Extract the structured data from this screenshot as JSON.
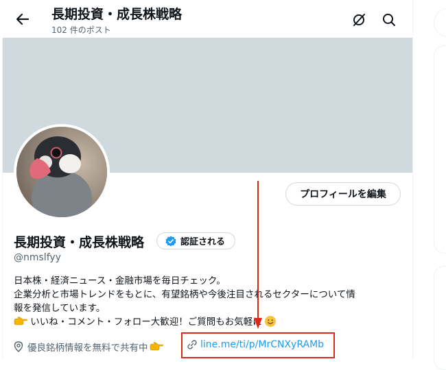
{
  "header": {
    "title": "長期投資・成長株戦略",
    "post_count": "102 件のポスト",
    "icons": [
      "back-arrow-icon",
      "grok-icon",
      "search-icon"
    ]
  },
  "profile": {
    "edit_button": "プロフィールを編集",
    "name": "長期投資・成長株戦略",
    "verify_button": "認証される",
    "handle": "@nmslfyy",
    "bio": [
      "日本株・経済ニュース・金融市場を毎日チェック。",
      "企業分析と市場トレンドをもとに、有望銘柄や今後注目されるセクターについて情",
      "報を発信しています。",
      "いいね・コメント・フォロー大歓迎！ご質問もお気軽に"
    ],
    "location": "優良銘柄情報を無料で共有中",
    "link": "line.me/ti/p/MrCNXyRAMb"
  },
  "colors": {
    "banner": "#cfd9de",
    "link": "#1d9bf0",
    "annotation": "#e0251b",
    "verified": "#1d9bf0"
  }
}
